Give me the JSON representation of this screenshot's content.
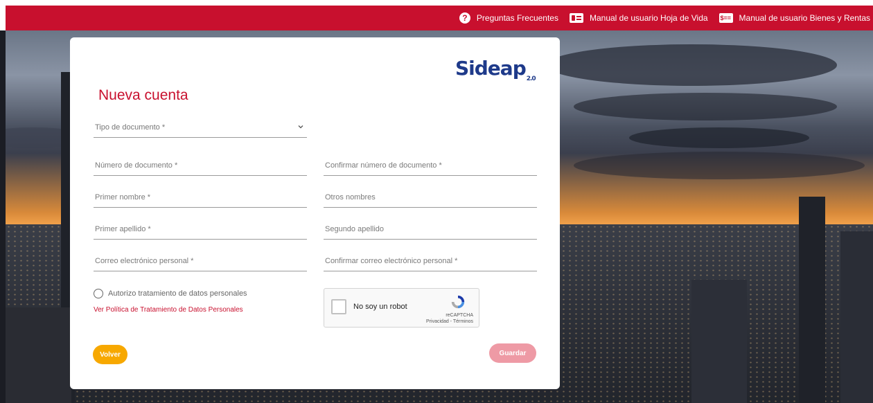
{
  "topbar": {
    "links": [
      {
        "label": "Preguntas Frecuentes",
        "icon": "question-icon"
      },
      {
        "label": "Manual de usuario Hoja de Vida",
        "icon": "id-card-icon"
      },
      {
        "label": "Manual de usuario Bienes y Rentas",
        "icon": "money-icon"
      }
    ],
    "color": "#c8102e"
  },
  "brand": {
    "logo_text": "Sideap",
    "logo_suffix": "2.0"
  },
  "form": {
    "title": "Nueva cuenta",
    "tipo_documento": "Tipo de documento *",
    "numero_documento": "Número de documento *",
    "confirmar_numero": "Confirmar número de documento *",
    "primer_nombre": "Primer nombre *",
    "otros_nombres": "Otros nombres",
    "primer_apellido": "Primer apellido *",
    "segundo_apellido": "Segundo apellido",
    "correo": "Correo electrónico personal *",
    "confirmar_correo": "Confirmar correo electrónico personal *",
    "autorizo": "Autorizo tratamiento de datos personales",
    "politica_link": "Ver Política de Tratamiento de Datos Personales"
  },
  "recaptcha": {
    "label": "No soy un robot",
    "brand": "reCAPTCHA",
    "links": "Privacidad - Términos"
  },
  "buttons": {
    "volver": "Volver",
    "guardar": "Guardar",
    "volver_color": "#f7a800",
    "guardar_color": "#ee9aa5"
  }
}
